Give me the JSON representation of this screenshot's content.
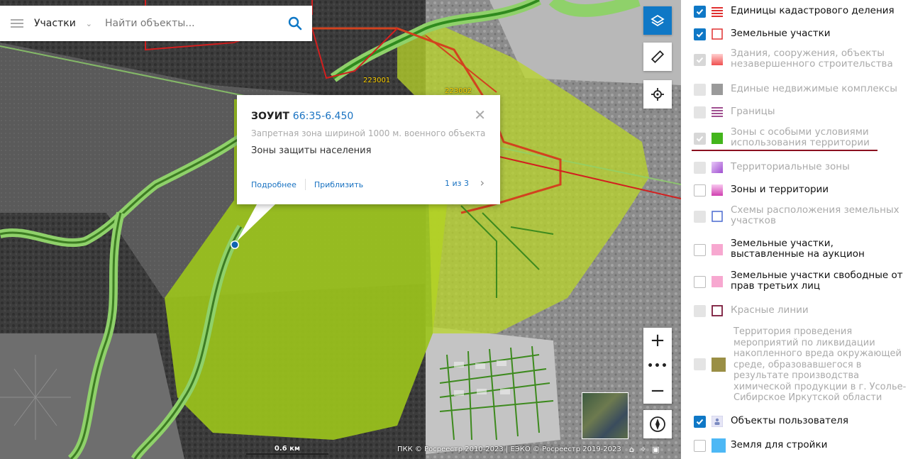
{
  "search": {
    "scope_label": "Участки",
    "placeholder": "Найти объекты..."
  },
  "map": {
    "parcel_labels": [
      "223001",
      "223002"
    ],
    "footer_text": "ПКК © Росреестр 2010-2023 | ЕЭКО © Росреестр 2019-2023",
    "scale_label": "0.6 км",
    "zoom_in_label": "+",
    "zoom_out_label": "−",
    "zoom_more_label": "•••"
  },
  "popup": {
    "title_prefix": "ЗОУИТ",
    "title_number": "66:35-6.450",
    "description": "Запретная зона шириной 1000 м. военного объекта...",
    "type": "Зоны защиты населения",
    "link_details": "Подробнее",
    "link_zoom": "Приблизить",
    "counter": "1 из 3"
  },
  "layers": [
    {
      "label": "Единицы кадастрового деления",
      "state": "on",
      "swatch": "red-lines"
    },
    {
      "label": "Земельные участки",
      "state": "on",
      "swatch": "red-outline"
    },
    {
      "label": "Здания, сооружения, объекты незавершенного строительства",
      "state": "on-disabled",
      "swatch": "red-fade"
    },
    {
      "label": "Единые недвижимые комплексы",
      "state": "off-disabled",
      "swatch": "gray"
    },
    {
      "label": "Границы",
      "state": "off-disabled",
      "swatch": "purple-lines"
    },
    {
      "label": "Зоны с особыми условиями использования территории",
      "state": "on-disabled",
      "swatch": "green"
    },
    {
      "label": "Территориальные зоны",
      "state": "off-disabled",
      "swatch": "violet-fade"
    },
    {
      "label": "Зоны и территории",
      "state": "off",
      "swatch": "magenta-fade"
    },
    {
      "label": "Схемы расположения земельных участков",
      "state": "off-disabled",
      "swatch": "blue-outline"
    },
    {
      "label": "Земельные участки, выставленные на аукцион",
      "state": "off",
      "swatch": "pink"
    },
    {
      "label": "Земельные участки свободные от прав третьих лиц",
      "state": "off",
      "swatch": "pink"
    },
    {
      "label": "Красные линии",
      "state": "off-disabled",
      "swatch": "maroon-outline"
    },
    {
      "label": "Территория проведения мероприятий по ликвидации накопленного вреда окружающей среде, образовавшегося в результате производства химической продукции в г. Усолье-Сибирское Иркутской области",
      "state": "off-disabled",
      "swatch": "olive"
    },
    {
      "label": "Объекты пользователя",
      "state": "on",
      "swatch": "user"
    },
    {
      "label": "Земля для стройки",
      "state": "off",
      "swatch": "sky"
    }
  ],
  "colors": {
    "accent": "#0f78c6",
    "zone_fill": "#9bc31c",
    "highlight_underline": "#8b1020"
  }
}
